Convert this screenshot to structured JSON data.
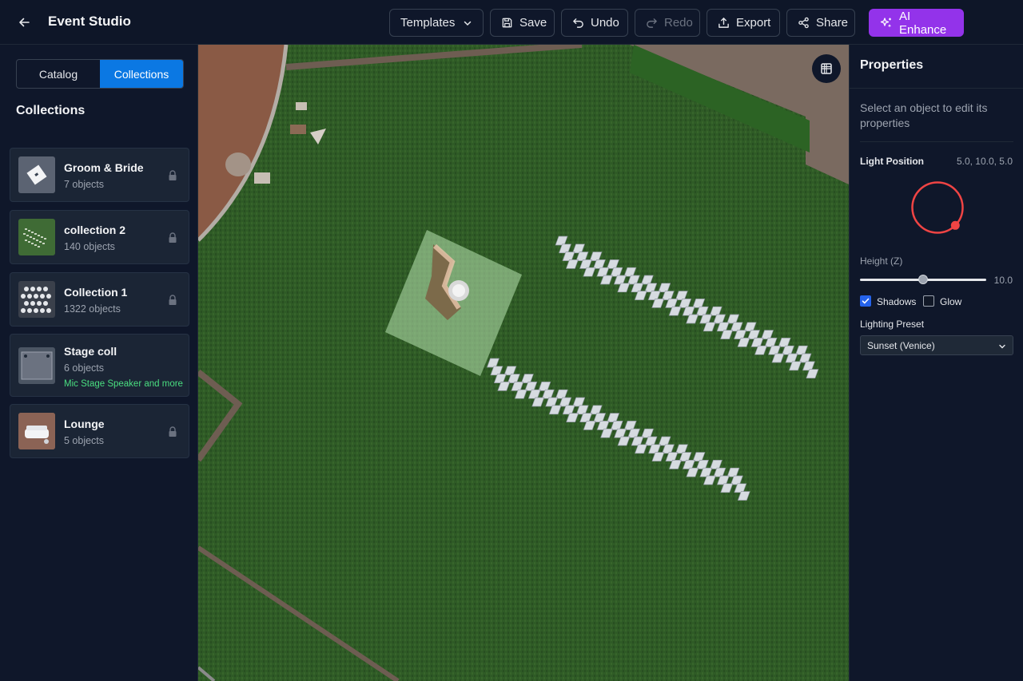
{
  "header": {
    "title": "Event Studio",
    "templates_label": "Templates",
    "save_label": "Save",
    "undo_label": "Undo",
    "redo_label": "Redo",
    "export_label": "Export",
    "share_label": "Share",
    "ai_label": "AI Enhance"
  },
  "sidebar": {
    "tabs": [
      {
        "label": "Catalog",
        "active": false
      },
      {
        "label": "Collections",
        "active": true
      }
    ],
    "title": "Collections",
    "collections": [
      {
        "name": "Groom & Bride",
        "count": "7 objects",
        "locked": true
      },
      {
        "name": "collection 2",
        "count": "140 objects",
        "locked": true
      },
      {
        "name": "Collection 1",
        "count": "1322 objects",
        "locked": true
      },
      {
        "name": "Stage coll",
        "count": "6 objects",
        "extra": "Mic Stage Speaker and more",
        "locked": false
      },
      {
        "name": "Lounge",
        "count": "5 objects",
        "locked": true
      }
    ]
  },
  "properties": {
    "title": "Properties",
    "hint": "Select an object to edit its properties",
    "light_position_label": "Light Position",
    "light_position_value": "5.0, 10.0, 5.0",
    "height_label": "Height (Z)",
    "height_value": "10.0",
    "height_fraction": 0.5,
    "shadows_label": "Shadows",
    "shadows_checked": true,
    "glow_label": "Glow",
    "glow_checked": false,
    "preset_label": "Lighting Preset",
    "preset_value": "Sunset (Venice)"
  },
  "colors": {
    "accent_blue": "#0b78e3",
    "ai_purple": "#9333ea",
    "dial_red": "#ef4444",
    "extra_green": "#4ade80"
  }
}
